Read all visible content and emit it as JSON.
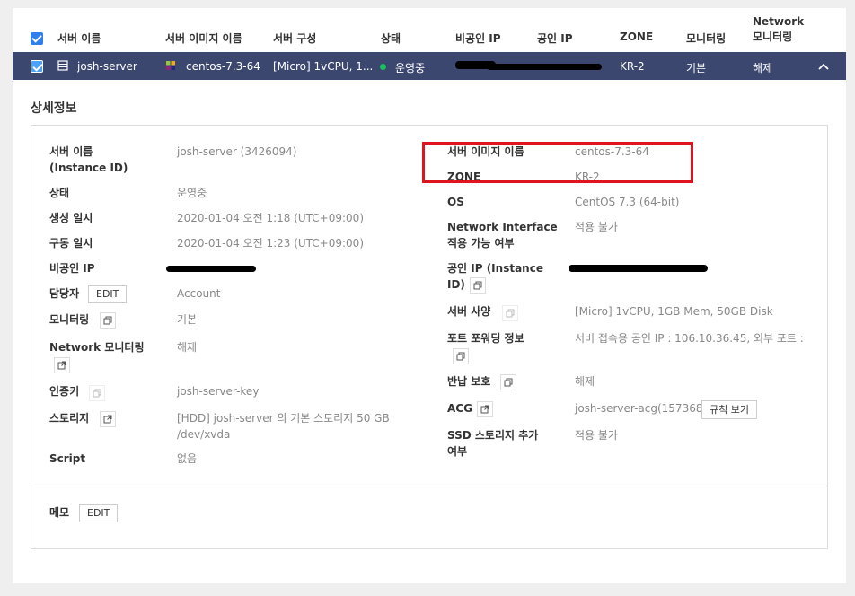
{
  "header": {
    "col_server_name": "서버 이름",
    "col_image_name": "서버 이미지 이름",
    "col_config": "서버 구성",
    "col_status": "상태",
    "col_private_ip": "비공인 IP",
    "col_public_ip": "공인 IP",
    "col_zone": "ZONE",
    "col_monitoring": "모니터링",
    "col_network_monitoring": "Network\n모니터링"
  },
  "row": {
    "server_name": "josh-server",
    "image_name": "centos-7.3-64",
    "config": "[Micro] 1vCPU, 1...",
    "status": "운영중",
    "zone": "KR-2",
    "monitoring": "기본",
    "network_monitoring": "해제"
  },
  "detail": {
    "title": "상세정보",
    "left": {
      "server_name_label": "서버 이름\n(Instance ID)",
      "server_name_value": "josh-server (3426094)",
      "status_label": "상태",
      "status_value": "운영중",
      "created_label": "생성 일시",
      "created_value": "2020-01-04 오전 1:18 (UTC+09:00)",
      "started_label": "구동 일시",
      "started_value": "2020-01-04 오전 1:23 (UTC+09:00)",
      "private_ip_label": "비공인 IP",
      "owner_label": "담당자",
      "owner_edit": "EDIT",
      "owner_value": "Account",
      "monitoring_label": "모니터링",
      "monitoring_value": "기본",
      "net_monitoring_label": "Network 모니터링",
      "net_monitoring_value": "해제",
      "auth_key_label": "인증키",
      "auth_key_value": "josh-server-key",
      "storage_label": "스토리지",
      "storage_value_1": "[HDD] josh-server 의 기본 스토리지  50 GB",
      "storage_value_2": "/dev/xvda",
      "script_label": "Script",
      "script_value": "없음"
    },
    "right": {
      "image_label": "서버 이미지 이름",
      "image_value": "centos-7.3-64",
      "zone_label": "ZONE",
      "zone_value": "KR-2",
      "os_label": "OS",
      "os_value": "CentOS 7.3 (64-bit)",
      "net_if_label": "Network Interface\n적용 가능 여부",
      "net_if_value": "적용 불가",
      "public_ip_label_1": "공인 IP (Instance",
      "public_ip_label_2": "ID)",
      "spec_label": "서버 사양",
      "spec_value": "[Micro] 1vCPU, 1GB Mem, 50GB Disk",
      "port_fw_label": "포트 포워딩 정보",
      "port_fw_value": "서버 접속용 공인 IP : 106.10.36.45, 외부 포트 :",
      "return_protect_label": "반납 보호",
      "return_protect_value": "해제",
      "acg_label": "ACG",
      "acg_value": "josh-server-acg(157368)",
      "acg_button": "규칙 보기",
      "ssd_label": "SSD 스토리지 추가\n여부",
      "ssd_value": "적용 불가"
    },
    "memo_label": "메모",
    "memo_edit": "EDIT"
  },
  "colors": {
    "row_bg": "#3c4770",
    "checkbox": "#2f80ed",
    "status_dot": "#19c15c",
    "highlight": "#e0141e"
  }
}
